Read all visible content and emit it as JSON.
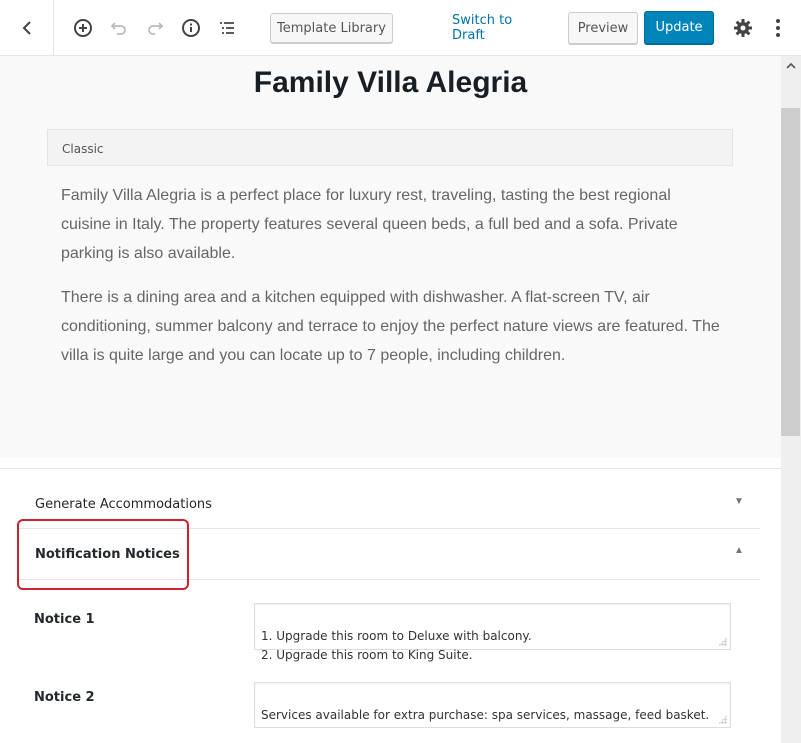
{
  "toolbar": {
    "back_icon": "chevron-left-icon",
    "add_icon": "plus-circle-icon",
    "undo_icon": "undo-icon",
    "redo_icon": "redo-icon",
    "info_icon": "info-icon",
    "outline_icon": "list-icon",
    "template_library_label": "Template Library",
    "switch_to_draft_label": "Switch to Draft",
    "preview_label": "Preview",
    "update_label": "Update",
    "settings_icon": "gear-icon",
    "more_icon": "vertical-ellipsis-icon",
    "accent_color": "#0085ba"
  },
  "editor": {
    "title": "Family Villa Alegria",
    "block_label": "Classic",
    "paragraphs": [
      "Family Villa Alegria is a perfect place for luxury rest, traveling, tasting the best regional cuisine in Italy. The property features several queen beds, a full bed and a sofa. Private parking is also available.",
      "There is a dining area and a kitchen equipped with dishwasher. A flat-screen TV, air conditioning, summer balcony and terrace to enjoy the perfect nature views are featured. The villa is quite large and you can locate up to 7 people, including children."
    ]
  },
  "meta_boxes": {
    "panels": [
      {
        "label": "Generate Accommodations",
        "state": "collapsed",
        "arrow": "▼"
      },
      {
        "label": "Notification Notices",
        "state": "expanded",
        "arrow": "▲",
        "highlighted": true
      }
    ],
    "fields": [
      {
        "label": "Notice 1",
        "value": "1. Upgrade this room to Deluxe with balcony.\n2. Upgrade this room to King Suite."
      },
      {
        "label": "Notice 2",
        "value": "Services available for extra purchase: spa services, massage, feed basket."
      }
    ],
    "highlight_color": "#d0222c"
  }
}
